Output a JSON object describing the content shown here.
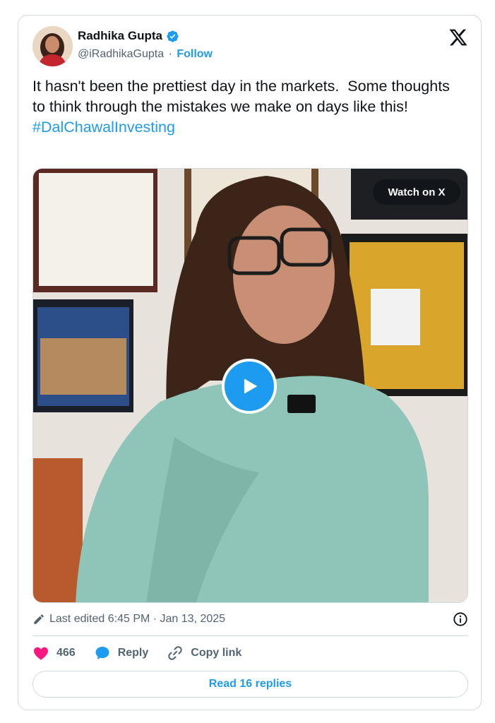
{
  "author": {
    "name": "Radhika Gupta",
    "handle": "@iRadhikaGupta",
    "separator": "·",
    "follow_label": "Follow"
  },
  "tweet": {
    "text": "It hasn't been the prettiest day in the markets.  Some thoughts to think through the mistakes we make on days like this!",
    "hashtag": "#DalChawalInvesting"
  },
  "media": {
    "watch_label": "Watch on X"
  },
  "meta": {
    "edited": "Last edited 6:45 PM · Jan 13, 2025"
  },
  "actions": {
    "likes": "466",
    "reply_label": "Reply",
    "copy_link_label": "Copy link"
  },
  "read_replies_label": "Read 16 replies",
  "colors": {
    "accent": "#1d9bf0",
    "like": "#f91880",
    "text": "#0f1419",
    "muted": "#536471",
    "border": "#cfd9de"
  }
}
